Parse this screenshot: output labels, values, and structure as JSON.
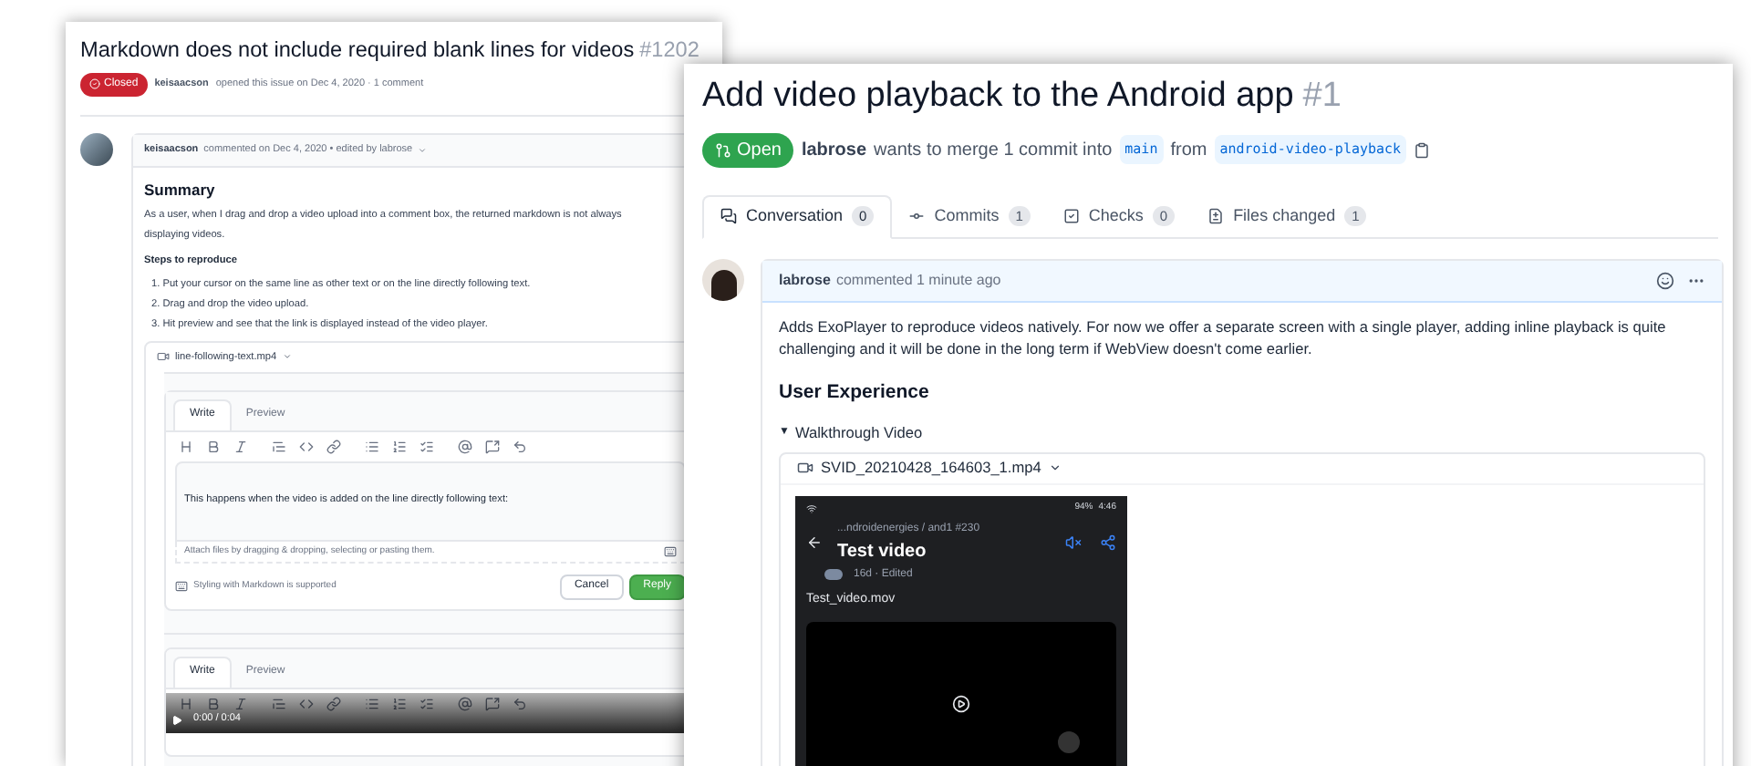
{
  "issue_window": {
    "title": "Markdown does not include required blank lines for videos",
    "number": "#1202",
    "state_badge": "Closed",
    "author": "keisaacson",
    "meta": "opened this issue on Dec 4, 2020 · 1 comment",
    "comment": {
      "author": "keisaacson",
      "meta": "commented on Dec 4, 2020 • edited by labrose",
      "heading": "Summary",
      "body_lines": [
        "As a user, when I drag and drop a video upload into a comment box, the returned markdown is not always",
        "displaying videos."
      ],
      "steps_heading": "Steps to reproduce",
      "steps": [
        "1. Put your cursor on the same line as other text or on the line directly following text.",
        "2. Drag and drop the video upload.",
        "3. Hit preview and see that the link is displayed instead of the video player."
      ],
      "attachment": "line-following-text.mp4"
    },
    "reply_editor": {
      "tabs": [
        {
          "label": "Write",
          "selected": true
        },
        {
          "label": "Preview",
          "selected": false
        }
      ],
      "value": "This happens when the video is added on the line directly following text:",
      "attach_hint": "Attach files by dragging & dropping, selecting or pasting them.",
      "markdown_note": "Styling with Markdown is supported",
      "buttons": [
        {
          "label": "Cancel",
          "kind": "secondary"
        },
        {
          "label": "Reply",
          "kind": "primary"
        }
      ]
    },
    "new_comment_editor": {
      "tabs": [
        {
          "label": "Write",
          "selected": true
        },
        {
          "label": "Preview",
          "selected": false
        }
      ]
    },
    "video_bar": {
      "time": "0:00 / 0:04"
    }
  },
  "pull_request_window": {
    "title": "Add video playback to the Android app",
    "number": "#1",
    "state_badge": "Open",
    "author": "labrose",
    "merge_text": "wants to merge 1 commit into",
    "base_branch": "main",
    "from_text": "from",
    "head_branch": "android-video-playback",
    "tabs": [
      {
        "label": "Conversation",
        "count": "0",
        "selected": true
      },
      {
        "label": "Commits",
        "count": "1",
        "selected": false
      },
      {
        "label": "Checks",
        "count": "0",
        "selected": false
      },
      {
        "label": "Files changed",
        "count": "1",
        "selected": false
      }
    ],
    "comment": {
      "author": "labrose",
      "meta": "commented 1 minute ago",
      "body": "Adds ExoPlayer to reproduce videos natively. For now we offer a separate screen with a single player, adding inline playback is quite challenging and it will be done in the long term if WebView doesn't come earlier.",
      "heading": "User Experience",
      "details_marker": "▼",
      "details_summary": "Walkthrough Video",
      "attachment": "SVID_20210428_164603_1.mp4",
      "phone": {
        "battery": "94%",
        "time": "4:46",
        "breadcrumb": "...ndroidenergies / and1 #230",
        "title": "Test video",
        "meta": "16d · Edited",
        "file": "Test_video.mov"
      }
    }
  }
}
